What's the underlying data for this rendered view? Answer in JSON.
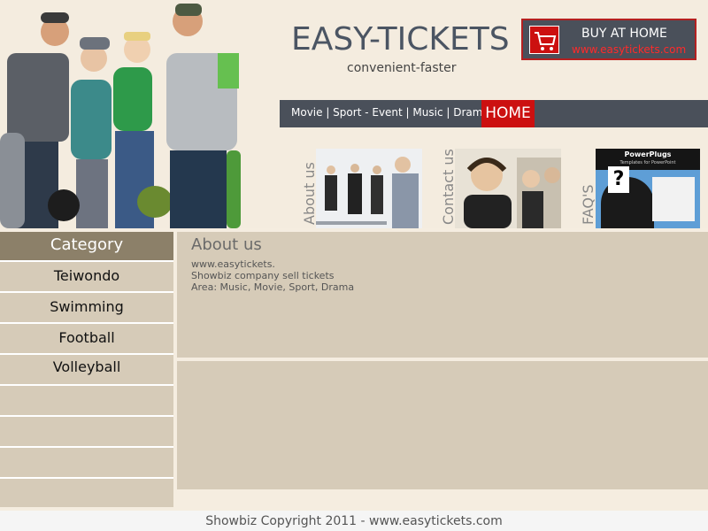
{
  "brand": {
    "title": "EASY-TICKETS",
    "tagline": "convenient-faster"
  },
  "buy_box": {
    "title": "BUY AT HOME",
    "url": "www.easytickets.com",
    "icon": "shopping-cart-icon"
  },
  "nav": {
    "links": "Movie | Sport - Event | Music | Drama",
    "home": "HOME"
  },
  "promos": [
    {
      "label": "About us"
    },
    {
      "label": "Contact us"
    },
    {
      "label": "FAQ'S",
      "image_title": "PowerPlugs",
      "image_subtitle": "Templates for PowerPoint"
    }
  ],
  "sidebar": {
    "header": "Category",
    "items": [
      "Teiwondo",
      "Swimming",
      "Football",
      "Volleyball",
      "",
      "",
      "",
      ""
    ]
  },
  "about": {
    "title": "About us",
    "lines": [
      "www.easytickets.",
      "Showbiz company sell tickets",
      "Area: Music, Movie, Sport, Drama"
    ]
  },
  "footer": {
    "text": "Showbiz Copyright 2011 - www.easytickets.com"
  },
  "colors": {
    "nav_bg": "#4a505a",
    "accent_red": "#cc1010",
    "panel_bg": "#d6cbb8",
    "category_header_bg": "#8c8069"
  }
}
